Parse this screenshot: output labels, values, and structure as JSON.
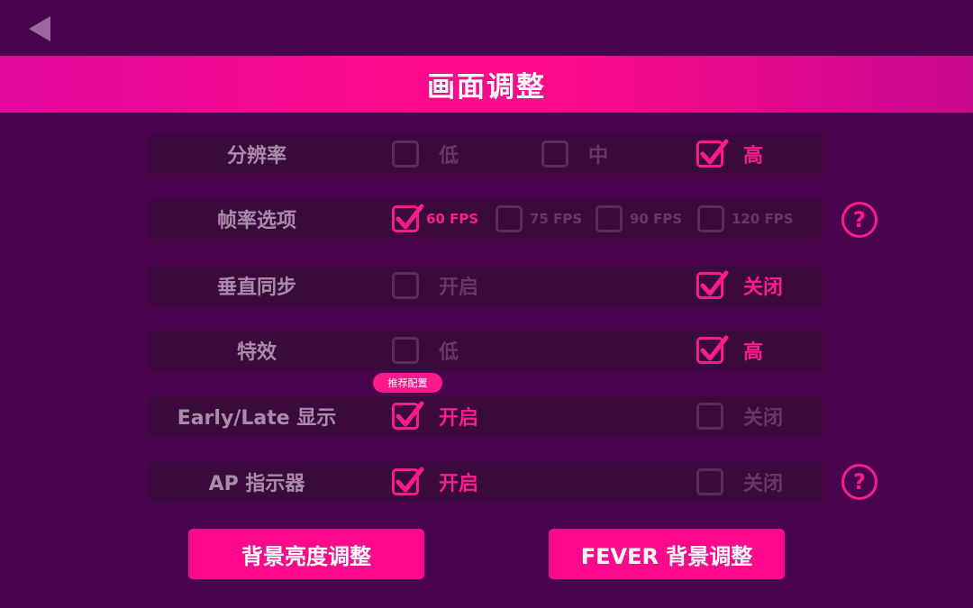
{
  "title": "画面调整",
  "colors": {
    "background": "#4a044f",
    "accent": "#ff1a8c",
    "row_bg": "#3a0a3c",
    "label": "#a98ca8",
    "inactive": "#6a3668"
  },
  "icons": {
    "back": "back-arrow-icon",
    "check": "checkmark-icon",
    "help": "question-icon"
  },
  "rows": [
    {
      "label": "分辨率",
      "options": [
        {
          "label": "低",
          "checked": false
        },
        {
          "label": "中",
          "checked": false
        },
        {
          "label": "高",
          "checked": true
        }
      ]
    },
    {
      "label": "帧率选项",
      "options": [
        {
          "label": "60 FPS",
          "checked": true
        },
        {
          "label": "75 FPS",
          "checked": false
        },
        {
          "label": "90 FPS",
          "checked": false
        },
        {
          "label": "120 FPS",
          "checked": false
        }
      ],
      "help": "?"
    },
    {
      "label": "垂直同步",
      "options": [
        {
          "label": "开启",
          "checked": false
        },
        {
          "label": "关闭",
          "checked": true
        }
      ]
    },
    {
      "label": "特效",
      "options": [
        {
          "label": "低",
          "checked": false
        },
        {
          "label": "高",
          "checked": true
        }
      ]
    },
    {
      "label": "Early/Late 显示",
      "options": [
        {
          "label": "开启",
          "checked": true
        },
        {
          "label": "关闭",
          "checked": false
        }
      ]
    },
    {
      "label": "AP 指示器",
      "options": [
        {
          "label": "开启",
          "checked": true
        },
        {
          "label": "关闭",
          "checked": false
        }
      ],
      "help": "?"
    }
  ],
  "recommended_tag": "推荐配置",
  "buttons": {
    "background_brightness": "背景亮度调整",
    "fever_background": "FEVER 背景调整"
  }
}
